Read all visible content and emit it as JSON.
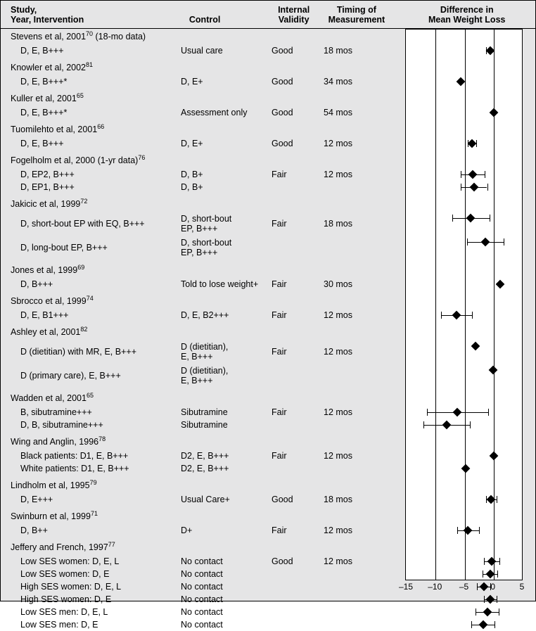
{
  "headers": {
    "study": "Study,\nYear, Intervention",
    "control": "Control",
    "validity": "Internal\nValidity",
    "timing": "Timing of\nMeasurement",
    "plot": "Difference in\nMean Weight Loss"
  },
  "axis": {
    "min": -15,
    "max": 5,
    "ticks": [
      -15,
      -10,
      -5,
      0,
      5
    ]
  },
  "groups": [
    {
      "title_parts": [
        "Stevens et al, 2001",
        "70",
        " (18-mo data)"
      ],
      "rows": [
        {
          "intervention": "D, E, B+++",
          "control": "Usual care",
          "validity": "Good",
          "timing": "18 mos",
          "point": -0.5,
          "ci": [
            -1.2,
            0.2
          ]
        }
      ]
    },
    {
      "title_parts": [
        "Knowler et al, 2002",
        "81",
        ""
      ],
      "rows": [
        {
          "intervention": "D, E, B+++*",
          "control": "D, E+",
          "validity": "Good",
          "timing": "34 mos",
          "point": -5.5,
          "ci": null
        }
      ]
    },
    {
      "title_parts": [
        "Kuller et al, 2001",
        "65",
        ""
      ],
      "rows": [
        {
          "intervention": "D, E, B+++*",
          "control": "Assessment only",
          "validity": "Good",
          "timing": "54 mos",
          "point": 0.1,
          "ci": null
        }
      ]
    },
    {
      "title_parts": [
        "Tuomilehto et al, 2001",
        "66",
        ""
      ],
      "rows": [
        {
          "intervention": "D, E, B+++",
          "control": "D, E+",
          "validity": "Good",
          "timing": "12 mos",
          "point": -3.6,
          "ci": [
            -4.3,
            -2.9
          ]
        }
      ]
    },
    {
      "title_parts": [
        "Fogelholm et al, 2000 (1-yr data)",
        "76",
        ""
      ],
      "rows": [
        {
          "intervention": "D, EP2, B+++",
          "control": "D, B+",
          "validity": "Fair",
          "timing": "12 mos",
          "point": -3.5,
          "ci": [
            -5.6,
            -1.4
          ]
        },
        {
          "intervention": "D, EP1, B+++",
          "control": "D, B+",
          "validity": "",
          "timing": "",
          "point": -3.3,
          "ci": [
            -5.6,
            -1.0
          ]
        }
      ]
    },
    {
      "title_parts": [
        "Jakicic et al, 1999",
        "72",
        ""
      ],
      "rows": [
        {
          "intervention": "D, short-bout EP with EQ, B+++",
          "control": "D, short-bout\nEP, B+++",
          "validity": "Fair",
          "timing": "18 mos",
          "point": -3.8,
          "ci": [
            -7.0,
            -0.6
          ]
        },
        {
          "intervention": "D, long-bout EP, B+++",
          "control": "D, short-bout\nEP, B+++",
          "validity": "",
          "timing": "",
          "point": -1.3,
          "ci": [
            -4.4,
            1.8
          ]
        }
      ]
    },
    {
      "title_parts": [
        "Jones et al, 1999",
        "69",
        ""
      ],
      "rows": [
        {
          "intervention": "D, B+++",
          "control": "Told to lose weight+",
          "validity": "Fair",
          "timing": "30 mos",
          "point": 1.2,
          "ci": null
        }
      ]
    },
    {
      "title_parts": [
        "Sbrocco et al, 1999",
        "74",
        ""
      ],
      "rows": [
        {
          "intervention": "D, E, B1+++",
          "control": "D, E, B2+++",
          "validity": "Fair",
          "timing": "12 mos",
          "point": -6.3,
          "ci": [
            -9.0,
            -3.6
          ]
        }
      ]
    },
    {
      "title_parts": [
        "Ashley et al, 2001",
        "82",
        ""
      ],
      "rows": [
        {
          "intervention": "D (dietitian) with MR, E, B+++",
          "control": "D (dietitian),\nE, B+++",
          "validity": "Fair",
          "timing": "12 mos",
          "point": -3.0,
          "ci": null
        },
        {
          "intervention": "D (primary care), E, B+++",
          "control": "D (dietitian),\nE, B+++",
          "validity": "",
          "timing": "",
          "point": 0.0,
          "ci": null
        }
      ]
    },
    {
      "title_parts": [
        "Wadden et al, 2001",
        "65",
        ""
      ],
      "rows": [
        {
          "intervention": "B, sibutramine+++",
          "control": "Sibutramine",
          "validity": "Fair",
          "timing": "12 mos",
          "point": -6.1,
          "ci": [
            -11.4,
            -0.8
          ]
        },
        {
          "intervention": "D, B, sibutramine+++",
          "control": "Sibutramine",
          "validity": "",
          "timing": "",
          "point": -8.0,
          "ci": [
            -12.0,
            -4.0
          ]
        }
      ]
    },
    {
      "title_parts": [
        "Wing and Anglin, 1996",
        "78",
        ""
      ],
      "rows": [
        {
          "intervention": "Black patients: D1, E, B+++",
          "control": "D2, E, B+++",
          "validity": "Fair",
          "timing": "12 mos",
          "point": 0.1,
          "ci": null
        },
        {
          "intervention": "White patients: D1, E, B+++",
          "control": "D2, E, B+++",
          "validity": "",
          "timing": "",
          "point": -4.7,
          "ci": null
        }
      ]
    },
    {
      "title_parts": [
        "Lindholm et al, 1995",
        "79",
        ""
      ],
      "rows": [
        {
          "intervention": "D, E+++",
          "control": "Usual Care+",
          "validity": "Good",
          "timing": "18 mos",
          "point": -0.3,
          "ci": [
            -1.2,
            0.6
          ]
        }
      ]
    },
    {
      "title_parts": [
        "Swinburn et al, 1999",
        "71",
        ""
      ],
      "rows": [
        {
          "intervention": "D, B++",
          "control": "D+",
          "validity": "Fair",
          "timing": "12 mos",
          "point": -4.3,
          "ci": [
            -6.2,
            -2.4
          ]
        }
      ]
    },
    {
      "title_parts": [
        "Jeffery and French, 1997",
        "77",
        ""
      ],
      "rows": [
        {
          "intervention": "Low SES women: D, E, L",
          "control": "No contact",
          "validity": "Good",
          "timing": "12 mos",
          "point": -0.2,
          "ci": [
            -1.5,
            1.1
          ]
        },
        {
          "intervention": "Low SES women: D, E",
          "control": "No contact",
          "validity": "",
          "timing": "",
          "point": -0.5,
          "ci": [
            -1.8,
            0.8
          ]
        },
        {
          "intervention": "High SES women: D, E, L",
          "control": "No contact",
          "validity": "",
          "timing": "",
          "point": -1.6,
          "ci": [
            -2.7,
            -0.5
          ]
        },
        {
          "intervention": "High SES women: D, E",
          "control": "No contact",
          "validity": "",
          "timing": "",
          "point": -0.5,
          "ci": [
            -1.6,
            0.6
          ]
        },
        {
          "intervention": "Low SES men: D, E, L",
          "control": "No contact",
          "validity": "",
          "timing": "",
          "point": -1.0,
          "ci": [
            -3.0,
            1.0
          ]
        },
        {
          "intervention": "Low SES men: D, E",
          "control": "No contact",
          "validity": "",
          "timing": "",
          "point": -1.7,
          "ci": [
            -3.7,
            0.3
          ]
        }
      ]
    }
  ],
  "chart_data": {
    "type": "scatter",
    "title": "Difference in Mean Weight Loss",
    "xlabel": "",
    "ylabel": "",
    "xlim": [
      -15,
      5
    ],
    "series": [
      {
        "name": "Stevens 2001 — D,E,B+++",
        "x": -0.5,
        "ci": [
          -1.2,
          0.2
        ]
      },
      {
        "name": "Knowler 2002 — D,E,B+++*",
        "x": -5.5,
        "ci": null
      },
      {
        "name": "Kuller 2001 — D,E,B+++*",
        "x": 0.1,
        "ci": null
      },
      {
        "name": "Tuomilehto 2001 — D,E,B+++",
        "x": -3.6,
        "ci": [
          -4.3,
          -2.9
        ]
      },
      {
        "name": "Fogelholm 2000 — D,EP2,B+++",
        "x": -3.5,
        "ci": [
          -5.6,
          -1.4
        ]
      },
      {
        "name": "Fogelholm 2000 — D,EP1,B+++",
        "x": -3.3,
        "ci": [
          -5.6,
          -1.0
        ]
      },
      {
        "name": "Jakicic 1999 — short-bout EP w/EQ",
        "x": -3.8,
        "ci": [
          -7.0,
          -0.6
        ]
      },
      {
        "name": "Jakicic 1999 — long-bout EP",
        "x": -1.3,
        "ci": [
          -4.4,
          1.8
        ]
      },
      {
        "name": "Jones 1999 — D,B+++",
        "x": 1.2,
        "ci": null
      },
      {
        "name": "Sbrocco 1999 — D,E,B1+++",
        "x": -6.3,
        "ci": [
          -9.0,
          -3.6
        ]
      },
      {
        "name": "Ashley 2001 — dietitian w/MR",
        "x": -3.0,
        "ci": null
      },
      {
        "name": "Ashley 2001 — primary care",
        "x": 0.0,
        "ci": null
      },
      {
        "name": "Wadden 2001 — B,sibutramine+++",
        "x": -6.1,
        "ci": [
          -11.4,
          -0.8
        ]
      },
      {
        "name": "Wadden 2001 — D,B,sibutramine+++",
        "x": -8.0,
        "ci": [
          -12.0,
          -4.0
        ]
      },
      {
        "name": "Wing 1996 — Black patients",
        "x": 0.1,
        "ci": null
      },
      {
        "name": "Wing 1996 — White patients",
        "x": -4.7,
        "ci": null
      },
      {
        "name": "Lindholm 1995 — D,E+++",
        "x": -0.3,
        "ci": [
          -1.2,
          0.6
        ]
      },
      {
        "name": "Swinburn 1999 — D,B++",
        "x": -4.3,
        "ci": [
          -6.2,
          -2.4
        ]
      },
      {
        "name": "Jeffery 1997 — Low SES women D,E,L",
        "x": -0.2,
        "ci": [
          -1.5,
          1.1
        ]
      },
      {
        "name": "Jeffery 1997 — Low SES women D,E",
        "x": -0.5,
        "ci": [
          -1.8,
          0.8
        ]
      },
      {
        "name": "Jeffery 1997 — High SES women D,E,L",
        "x": -1.6,
        "ci": [
          -2.7,
          -0.5
        ]
      },
      {
        "name": "Jeffery 1997 — High SES women D,E",
        "x": -0.5,
        "ci": [
          -1.6,
          0.6
        ]
      },
      {
        "name": "Jeffery 1997 — Low SES men D,E,L",
        "x": -1.0,
        "ci": [
          -3.0,
          1.0
        ]
      },
      {
        "name": "Jeffery 1997 — Low SES men D,E",
        "x": -1.7,
        "ci": [
          -3.7,
          0.3
        ]
      }
    ]
  }
}
